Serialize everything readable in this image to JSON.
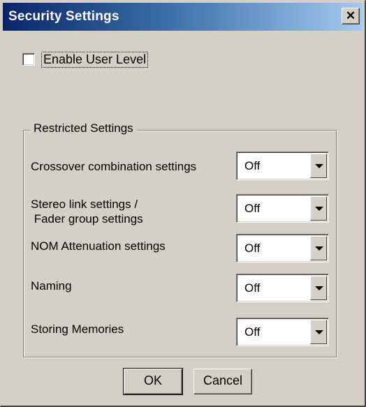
{
  "window": {
    "title": "Security Settings",
    "close_symbol": "✕"
  },
  "enable_user_level": {
    "label": "Enable User Level",
    "checked": false
  },
  "restricted": {
    "legend": "Restricted Settings",
    "items": [
      {
        "label": "Crossover combination settings",
        "value": "Off"
      },
      {
        "label": "Stereo link settings /\n Fader group settings",
        "value": "Off"
      },
      {
        "label": "NOM Attenuation settings",
        "value": "Off"
      },
      {
        "label": "Naming",
        "value": "Off"
      },
      {
        "label": "Storing Memories",
        "value": "Off"
      }
    ]
  },
  "buttons": {
    "ok": "OK",
    "cancel": "Cancel"
  }
}
